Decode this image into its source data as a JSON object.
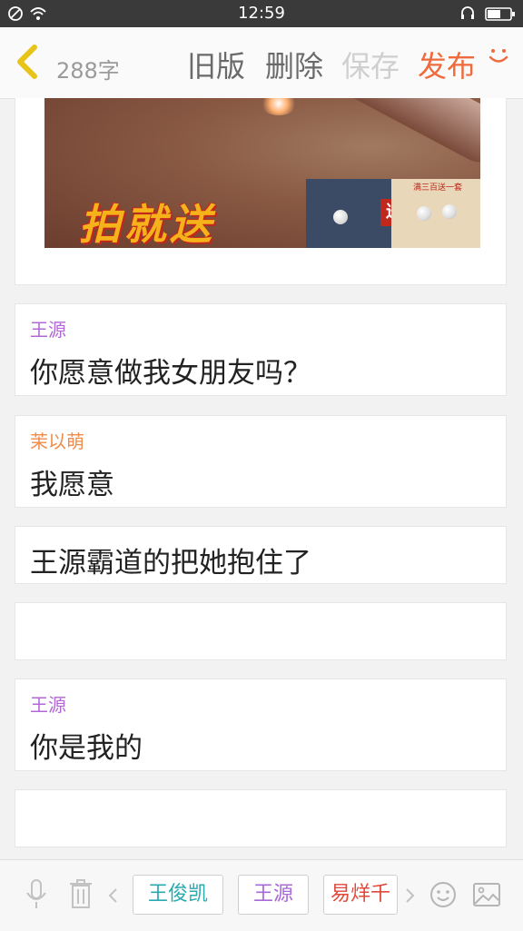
{
  "status_bar": {
    "time": "12:59"
  },
  "toolbar": {
    "word_count": "288字",
    "old_version": "旧版",
    "delete": "删除",
    "save": "保存",
    "publish": "发布"
  },
  "banner": {
    "promo_text": "拍就送",
    "stamp": "送",
    "tag": "满三百送一套"
  },
  "dialogues": [
    {
      "speaker": "王源",
      "text": "你愿意做我女朋友吗？",
      "speaker_color": "#b168d6"
    },
    {
      "speaker": "茉以萌",
      "text": "我愿意",
      "speaker_color": "#f08c4a"
    },
    {
      "text": "王源霸道的把她抱住了"
    },
    {
      "text": ""
    },
    {
      "speaker": "王源",
      "text": "你是我的",
      "speaker_color": "#b168d6"
    },
    {
      "text": ""
    }
  ],
  "character_chips": [
    {
      "name": "王俊凯",
      "color": "#2aaab0"
    },
    {
      "name": "王源",
      "color": "#a86ad6"
    },
    {
      "name": "易烊千",
      "color": "#e0483a"
    }
  ],
  "colors": {
    "accent": "#ef6a3c",
    "muted": "#9a9a9a",
    "disabled": "#cfcfcf"
  },
  "icons": [
    "wifi-icon",
    "do-not-disturb-icon",
    "headset-icon",
    "battery-icon",
    "back-chevron-icon",
    "smile-icon",
    "microphone-icon",
    "trash-icon",
    "chevron-left-icon",
    "chevron-right-icon",
    "emoji-icon",
    "image-icon"
  ]
}
